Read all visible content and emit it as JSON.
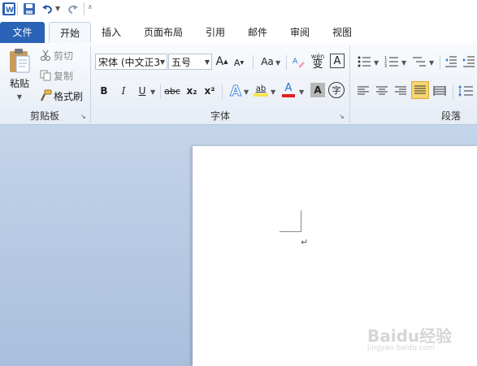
{
  "quick_access": {
    "app_icon": "word-app-icon",
    "save_icon": "save-icon",
    "undo_icon": "undo-icon",
    "redo_icon": "redo-icon",
    "customize_icon": "customize-qat-icon"
  },
  "tabs": [
    {
      "label": "文件"
    },
    {
      "label": "开始"
    },
    {
      "label": "插入"
    },
    {
      "label": "页面布局"
    },
    {
      "label": "引用"
    },
    {
      "label": "邮件"
    },
    {
      "label": "审阅"
    },
    {
      "label": "视图"
    }
  ],
  "clipboard": {
    "paste_label": "粘贴",
    "cut_label": "剪切",
    "copy_label": "复制",
    "format_painter_label": "格式刷",
    "group_label": "剪贴板"
  },
  "font": {
    "font_name": "宋体 (中文正3",
    "font_size": "五号",
    "grow_label": "A",
    "shrink_label": "A",
    "change_case_label": "Aa",
    "phonetic_label": "wén",
    "phonetic_char": "变",
    "border_char": "A",
    "bold": "B",
    "italic": "I",
    "underline": "U",
    "strikethrough": "abc",
    "subscript": "x₂",
    "superscript": "x²",
    "text_effect": "A",
    "highlight": "ab",
    "font_color": "A",
    "shading_char": "A",
    "enclose_char": "字",
    "group_label": "字体"
  },
  "paragraph": {
    "group_label": "段落"
  },
  "document": {
    "paragraph_mark": "↵"
  },
  "watermark": {
    "brand": "Baidu经验",
    "url": "jingyan.baidu.com"
  },
  "colors": {
    "file_tab": "#2b63b6",
    "highlight_yellow": "#f5e44a",
    "font_red": "#e02020",
    "accent_blue": "#2f6fd6"
  }
}
